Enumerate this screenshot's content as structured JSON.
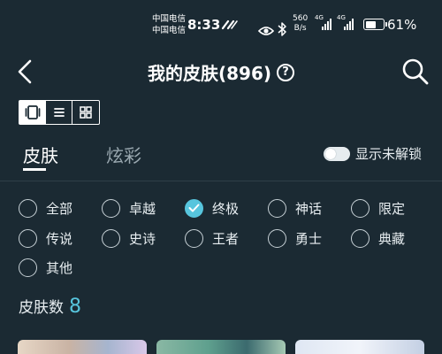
{
  "status_bar": {
    "carrier_1": "中国电信",
    "carrier_2": "中国电信",
    "time": "8:33",
    "net_speed_value": "560",
    "net_speed_unit": "B/s",
    "signal_1_label": "4G",
    "signal_2_label": "4G",
    "battery_text": "61%",
    "battery_level": 0.61
  },
  "header": {
    "title": "我的皮肤(896)",
    "help_label": "?",
    "back_icon": "chevron-left-icon",
    "search_icon": "search-icon"
  },
  "view_toggle": {
    "modes": [
      "card-view-icon",
      "list-view-icon",
      "grid-view-icon"
    ],
    "active_index": 0
  },
  "tabs": [
    {
      "label": "皮肤",
      "active": true
    },
    {
      "label": "炫彩",
      "active": false
    }
  ],
  "unlock_toggle": {
    "label": "显示未解锁",
    "on": false
  },
  "filters": [
    {
      "label": "全部",
      "checked": false
    },
    {
      "label": "卓越",
      "checked": false
    },
    {
      "label": "终极",
      "checked": true
    },
    {
      "label": "神话",
      "checked": false
    },
    {
      "label": "限定",
      "checked": false
    },
    {
      "label": "传说",
      "checked": false
    },
    {
      "label": "史诗",
      "checked": false
    },
    {
      "label": "王者",
      "checked": false
    },
    {
      "label": "勇士",
      "checked": false
    },
    {
      "label": "典藏",
      "checked": false
    },
    {
      "label": "其他",
      "checked": false
    }
  ],
  "skin_count": {
    "label": "皮肤数",
    "value": "8"
  },
  "colors": {
    "background": "#1b2a33",
    "accent": "#57c5dd",
    "text": "#e8eef1",
    "muted_text": "#9aa8b0"
  }
}
